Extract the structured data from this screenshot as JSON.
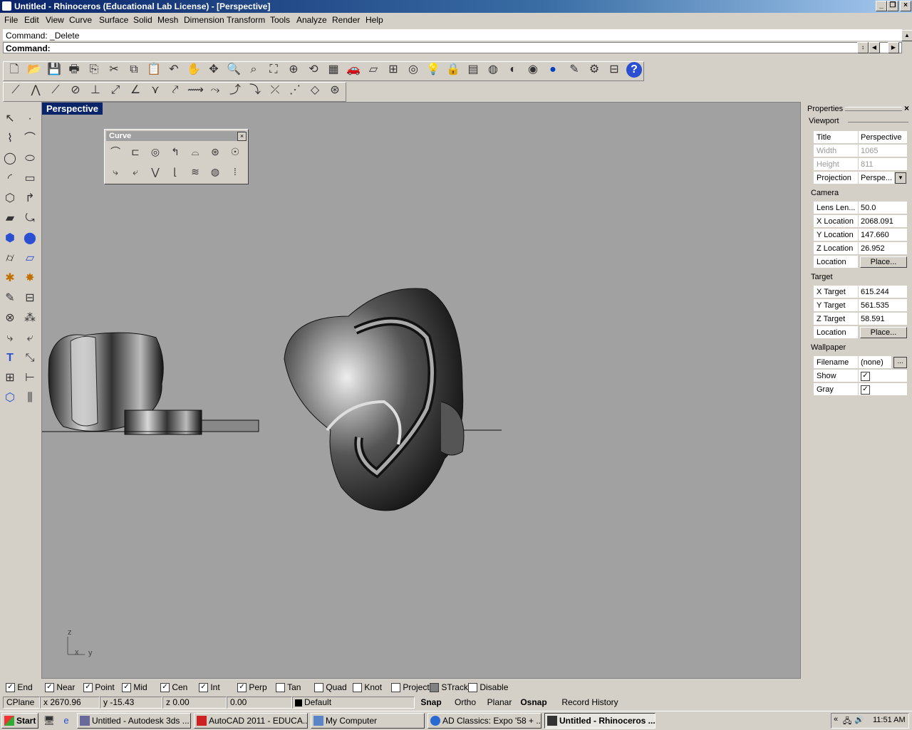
{
  "window": {
    "title": "Untitled - Rhinoceros (Educational Lab License) - [Perspective]"
  },
  "menu": [
    "File",
    "Edit",
    "View",
    "Curve",
    "Surface",
    "Solid",
    "Mesh",
    "Dimension",
    "Transform",
    "Tools",
    "Analyze",
    "Render",
    "Help"
  ],
  "command": {
    "history": "Command: _Delete",
    "prompt_label": "Command:",
    "value": ""
  },
  "viewport": {
    "tab_title": "Perspective",
    "axis_labels": {
      "z": "z",
      "x": "x",
      "y": "y"
    }
  },
  "curve_palette": {
    "title": "Curve"
  },
  "properties": {
    "title": "Properties",
    "section_viewport": "Viewport",
    "title_label": "Title",
    "title_value": "Perspective",
    "width_label": "Width",
    "width_value": "1065",
    "height_label": "Height",
    "height_value": "811",
    "projection_label": "Projection",
    "projection_value": "Perspe...",
    "section_camera": "Camera",
    "lens_label": "Lens Len...",
    "lens_value": "50.0",
    "xloc_label": "X Location",
    "xloc_value": "2068.091",
    "yloc_label": "Y Location",
    "yloc_value": "147.660",
    "zloc_label": "Z Location",
    "zloc_value": "26.952",
    "location_label": "Location",
    "place_label": "Place...",
    "section_target": "Target",
    "xt_label": "X Target",
    "xt_value": "615.244",
    "yt_label": "Y Target",
    "yt_value": "561.535",
    "zt_label": "Z Target",
    "zt_value": "58.591",
    "tloc_label": "Location",
    "tplace_label": "Place...",
    "section_wallpaper": "Wallpaper",
    "filename_label": "Filename",
    "filename_value": "(none)",
    "browse_label": "...",
    "show_label": "Show",
    "gray_label": "Gray"
  },
  "osnap": {
    "end": "End",
    "near": "Near",
    "point": "Point",
    "mid": "Mid",
    "cen": "Cen",
    "int": "Int",
    "perp": "Perp",
    "tan": "Tan",
    "quad": "Quad",
    "knot": "Knot",
    "project": "Project",
    "strack": "STrack",
    "disable": "Disable"
  },
  "status": {
    "cplane": "CPlane",
    "x": "x 2670.96",
    "y": "y -15.43",
    "z": "z 0.00",
    "extra": "0.00",
    "layer": "Default",
    "snap": "Snap",
    "ortho": "Ortho",
    "planar": "Planar",
    "osnap": "Osnap",
    "record_history": "Record History"
  },
  "taskbar": {
    "start": "Start",
    "tasks": [
      "Untitled - Autodesk 3ds ...",
      "AutoCAD 2011 - EDUCA...",
      "My Computer",
      "AD Classics: Expo '58 + ...",
      "Untitled - Rhinoceros ..."
    ],
    "clock": "11:51 AM"
  },
  "colors": {
    "titlebar": "#0a246a",
    "viewport_bg": "#a1a1a1",
    "chrome": "#d4d0c8"
  }
}
